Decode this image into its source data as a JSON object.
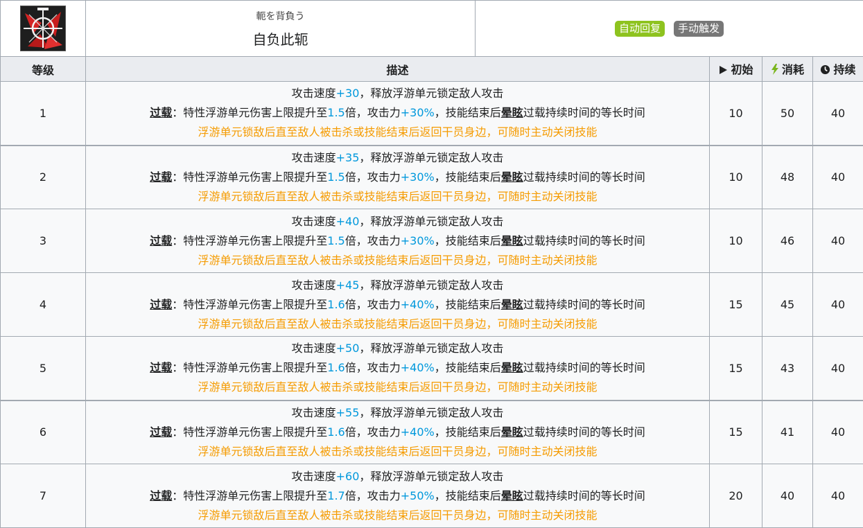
{
  "skill": {
    "subtitle": "軛を背負う",
    "title": "自负此轭",
    "tags": [
      {
        "label": "自动回复",
        "color": "#8ec31f"
      },
      {
        "label": "手动触发",
        "color": "#777777"
      }
    ]
  },
  "columns": {
    "level": "等级",
    "description": "描述",
    "initial": "初始",
    "cost": "消耗",
    "duration": "持续",
    "initial_icon": "play-icon",
    "cost_icon": "lightning-icon",
    "duration_icon": "clock-icon"
  },
  "common": {
    "line1_prefix": "攻击速度",
    "line1_suffix": "，释放浮游单元锁定敌人攻击",
    "overload_label": "过载",
    "line2_a": "：特性浮游单元伤害上限提升至",
    "line2_b": "倍，攻击力",
    "line2_c": "，技能结束后",
    "stun_label": "晕眩",
    "line2_d": "过载持续时间的等长时间",
    "line3": "浮游单元锁敌后直至敌人被击杀或技能结束后返回干员身边，可随时主动关闭技能"
  },
  "rows": [
    {
      "level": "1",
      "atk_speed": "+30",
      "cap": "1.5",
      "atk": "+30%",
      "initial": "10",
      "cost": "50",
      "duration": "40"
    },
    {
      "level": "2",
      "atk_speed": "+35",
      "cap": "1.5",
      "atk": "+30%",
      "initial": "10",
      "cost": "48",
      "duration": "40"
    },
    {
      "level": "3",
      "atk_speed": "+40",
      "cap": "1.5",
      "atk": "+30%",
      "initial": "10",
      "cost": "46",
      "duration": "40"
    },
    {
      "level": "4",
      "atk_speed": "+45",
      "cap": "1.6",
      "atk": "+40%",
      "initial": "15",
      "cost": "45",
      "duration": "40"
    },
    {
      "level": "5",
      "atk_speed": "+50",
      "cap": "1.6",
      "atk": "+40%",
      "initial": "15",
      "cost": "43",
      "duration": "40"
    },
    {
      "level": "6",
      "atk_speed": "+55",
      "cap": "1.6",
      "atk": "+40%",
      "initial": "15",
      "cost": "41",
      "duration": "40"
    },
    {
      "level": "7",
      "atk_speed": "+60",
      "cap": "1.7",
      "atk": "+50%",
      "initial": "20",
      "cost": "40",
      "duration": "40"
    }
  ],
  "colors": {
    "header_bg": "#eaecf0",
    "row_bg": "#f8f9fa",
    "border": "#a2a9b1",
    "blue_value": "#0098dc",
    "orange_note": "#f59b00",
    "cost_icon": "#7ab51d"
  }
}
